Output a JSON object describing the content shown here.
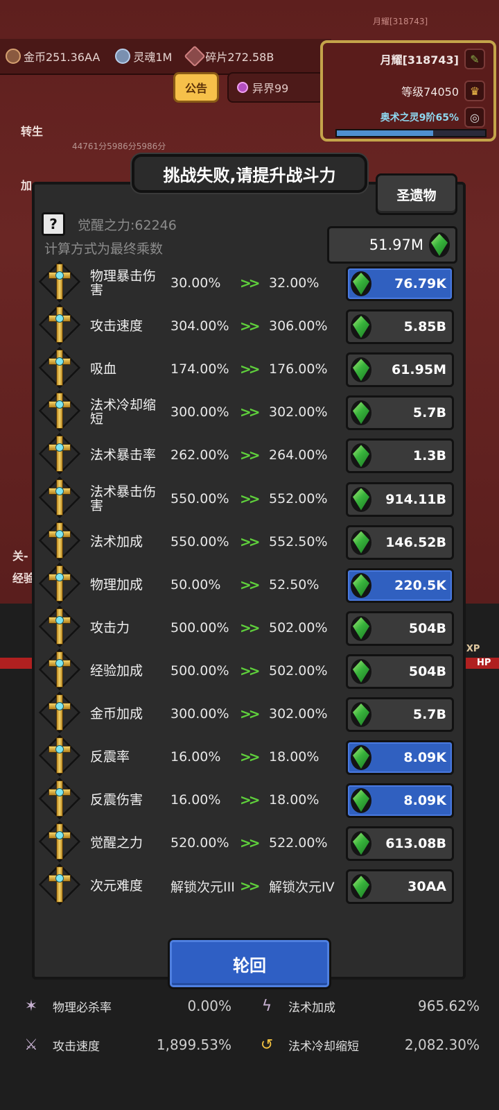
{
  "header": {
    "player_small": "月耀[318743]",
    "resources": [
      {
        "icon": "gold-coin-icon",
        "label": "金币251.36AA"
      },
      {
        "icon": "soul-icon",
        "label": "灵魂1M"
      },
      {
        "icon": "shard-icon",
        "label": "碎片272.58B"
      }
    ],
    "notice_button": "公告",
    "realm_button": "异界99",
    "player_name": "月耀[318743]",
    "player_level": "等级74050",
    "arcane": "奥术之灵9阶65%",
    "arcane_progress": 0.65
  },
  "background": {
    "rebirth_label": "转生",
    "side_label": "加",
    "score_text": "44761分5986分5986分",
    "stage_label": "关-",
    "exp_label": "经验",
    "exp_tag": "EXP",
    "hp_tag": "HP",
    "bottom_stats": [
      {
        "icon": "physical-kill-icon",
        "label": "物理必杀率",
        "value": "0.00%"
      },
      {
        "icon": "magic-bonus-icon",
        "label": "法术加成",
        "value": "965.62%"
      },
      {
        "icon": "attack-speed-icon",
        "label": "攻击速度",
        "value": "1,899.53%"
      },
      {
        "icon": "cooldown-icon",
        "label": "法术冷却缩短",
        "value": "2,082.30%"
      }
    ]
  },
  "toast": "挑战失败,请提升战斗力",
  "modal": {
    "relic_button": "圣遗物",
    "help_symbol": "?",
    "awaken_power": "觉醒之力:62246",
    "calc_note": "计算方式为最终乘数",
    "currency": "51.97M",
    "arrow": ">>",
    "rows": [
      {
        "name": "物理暴击伤害",
        "from": "30.00%",
        "to": "32.00%",
        "cost": "76.79K",
        "affordable": true
      },
      {
        "name": "攻击速度",
        "from": "304.00%",
        "to": "306.00%",
        "cost": "5.85B",
        "affordable": false
      },
      {
        "name": "吸血",
        "from": "174.00%",
        "to": "176.00%",
        "cost": "61.95M",
        "affordable": false
      },
      {
        "name": "法术冷却缩短",
        "from": "300.00%",
        "to": "302.00%",
        "cost": "5.7B",
        "affordable": false
      },
      {
        "name": "法术暴击率",
        "from": "262.00%",
        "to": "264.00%",
        "cost": "1.3B",
        "affordable": false
      },
      {
        "name": "法术暴击伤害",
        "from": "550.00%",
        "to": "552.00%",
        "cost": "914.11B",
        "affordable": false
      },
      {
        "name": "法术加成",
        "from": "550.00%",
        "to": "552.50%",
        "cost": "146.52B",
        "affordable": false
      },
      {
        "name": "物理加成",
        "from": "50.00%",
        "to": "52.50%",
        "cost": "220.5K",
        "affordable": true
      },
      {
        "name": "攻击力",
        "from": "500.00%",
        "to": "502.00%",
        "cost": "504B",
        "affordable": false
      },
      {
        "name": "经验加成",
        "from": "500.00%",
        "to": "502.00%",
        "cost": "504B",
        "affordable": false
      },
      {
        "name": "金币加成",
        "from": "300.00%",
        "to": "302.00%",
        "cost": "5.7B",
        "affordable": false
      },
      {
        "name": "反震率",
        "from": "16.00%",
        "to": "18.00%",
        "cost": "8.09K",
        "affordable": true
      },
      {
        "name": "反震伤害",
        "from": "16.00%",
        "to": "18.00%",
        "cost": "8.09K",
        "affordable": true
      },
      {
        "name": "觉醒之力",
        "from": "520.00%",
        "to": "522.00%",
        "cost": "613.08B",
        "affordable": false
      },
      {
        "name": "次元难度",
        "from": "解锁次元III",
        "to": "解锁次元IV",
        "cost": "30AA",
        "affordable": false
      }
    ],
    "reincarnate_button": "轮回"
  }
}
